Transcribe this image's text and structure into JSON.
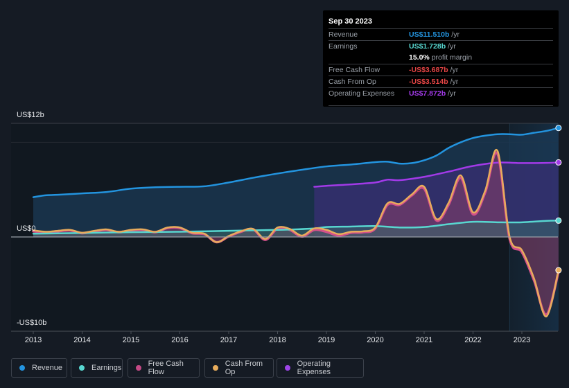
{
  "chart_data": {
    "type": "line",
    "title": "",
    "xlabel": "",
    "ylabel": "",
    "ylim": [
      -10,
      12
    ],
    "xlim": [
      2013,
      2023.75
    ],
    "y_ticks": [
      {
        "value": 12,
        "label": "US$12b"
      },
      {
        "value": 0,
        "label": "US$0"
      },
      {
        "value": -10,
        "label": "-US$10b"
      }
    ],
    "x_ticks": [
      "2013",
      "2014",
      "2015",
      "2016",
      "2017",
      "2018",
      "2019",
      "2020",
      "2021",
      "2022",
      "2023"
    ],
    "highlight_range": [
      2022.75,
      2023.75
    ],
    "legend_position": "bottom-left",
    "series": [
      {
        "name": "Revenue",
        "color": "#2394df",
        "fill": true,
        "x": [
          2013.0,
          2013.25,
          2013.5,
          2014.0,
          2014.5,
          2015.0,
          2015.5,
          2016.0,
          2016.5,
          2017.0,
          2017.5,
          2018.0,
          2018.5,
          2019.0,
          2019.5,
          2020.0,
          2020.25,
          2020.5,
          2020.75,
          2021.0,
          2021.25,
          2021.5,
          2021.75,
          2022.0,
          2022.25,
          2022.5,
          2022.75,
          2023.0,
          2023.25,
          2023.5,
          2023.75
        ],
        "values": [
          4.2,
          4.4,
          4.45,
          4.6,
          4.75,
          5.1,
          5.25,
          5.3,
          5.35,
          5.75,
          6.25,
          6.7,
          7.1,
          7.45,
          7.65,
          7.9,
          7.95,
          7.75,
          7.8,
          8.1,
          8.6,
          9.4,
          10.0,
          10.45,
          10.7,
          10.85,
          10.85,
          10.8,
          11.0,
          11.2,
          11.51
        ]
      },
      {
        "name": "Earnings",
        "color": "#58d7d0",
        "fill": true,
        "x": [
          2013.0,
          2014.0,
          2015.0,
          2016.0,
          2017.0,
          2018.0,
          2018.75,
          2019.0,
          2019.5,
          2020.0,
          2020.5,
          2021.0,
          2021.5,
          2022.0,
          2022.5,
          2023.0,
          2023.5,
          2023.75
        ],
        "values": [
          0.35,
          0.42,
          0.5,
          0.55,
          0.65,
          0.75,
          0.9,
          1.05,
          1.1,
          1.15,
          1.0,
          1.05,
          1.35,
          1.6,
          1.55,
          1.55,
          1.7,
          1.728
        ]
      },
      {
        "name": "Operating Expenses",
        "color": "#a23ae8",
        "fill": true,
        "x": [
          2018.75,
          2019.0,
          2019.5,
          2020.0,
          2020.25,
          2020.5,
          2021.0,
          2021.5,
          2022.0,
          2022.5,
          2023.0,
          2023.5,
          2023.75
        ],
        "values": [
          5.3,
          5.4,
          5.55,
          5.75,
          6.05,
          6.0,
          6.35,
          6.9,
          7.5,
          7.85,
          7.8,
          7.82,
          7.872
        ]
      },
      {
        "name": "Free Cash Flow",
        "color": "#d3518a",
        "fill": true,
        "x": [
          2013.0,
          2013.25,
          2013.5,
          2013.75,
          2014.0,
          2014.25,
          2014.5,
          2014.75,
          2015.0,
          2015.25,
          2015.5,
          2015.75,
          2016.0,
          2016.25,
          2016.5,
          2016.75,
          2017.0,
          2017.25,
          2017.5,
          2017.75,
          2018.0,
          2018.25,
          2018.5,
          2018.75,
          2019.0,
          2019.25,
          2019.5,
          2019.75,
          2020.0,
          2020.25,
          2020.5,
          2020.75,
          2021.0,
          2021.25,
          2021.5,
          2021.75,
          2022.0,
          2022.25,
          2022.5,
          2022.75,
          2023.0,
          2023.25,
          2023.5,
          2023.75
        ],
        "values": [
          0.6,
          0.5,
          0.6,
          0.7,
          0.4,
          0.6,
          0.75,
          0.5,
          0.7,
          0.75,
          0.5,
          0.95,
          0.95,
          0.4,
          0.3,
          -0.55,
          0.05,
          0.55,
          0.8,
          -0.3,
          0.9,
          0.75,
          0.05,
          0.75,
          0.55,
          0.15,
          0.45,
          0.5,
          0.9,
          3.4,
          3.4,
          4.4,
          5.1,
          1.75,
          3.4,
          6.25,
          2.4,
          4.7,
          8.8,
          -0.2,
          -1.6,
          -4.6,
          -8.2,
          -3.687
        ]
      },
      {
        "name": "Cash From Op",
        "color": "#e8ac5c",
        "fill": false,
        "x": [
          2013.0,
          2013.25,
          2013.5,
          2013.75,
          2014.0,
          2014.25,
          2014.5,
          2014.75,
          2015.0,
          2015.25,
          2015.5,
          2015.75,
          2016.0,
          2016.25,
          2016.5,
          2016.75,
          2017.0,
          2017.25,
          2017.5,
          2017.75,
          2018.0,
          2018.25,
          2018.5,
          2018.75,
          2019.0,
          2019.25,
          2019.5,
          2019.75,
          2020.0,
          2020.25,
          2020.5,
          2020.75,
          2021.0,
          2021.25,
          2021.5,
          2021.75,
          2022.0,
          2022.25,
          2022.5,
          2022.75,
          2023.0,
          2023.25,
          2023.5,
          2023.75
        ],
        "values": [
          0.7,
          0.55,
          0.65,
          0.75,
          0.45,
          0.65,
          0.8,
          0.55,
          0.75,
          0.8,
          0.55,
          1.0,
          1.0,
          0.45,
          0.35,
          -0.55,
          0.1,
          0.6,
          0.85,
          -0.2,
          1.0,
          0.85,
          0.15,
          0.9,
          0.75,
          0.3,
          0.55,
          0.6,
          1.0,
          3.55,
          3.5,
          4.5,
          5.3,
          1.9,
          3.6,
          6.5,
          2.6,
          4.9,
          9.1,
          0.0,
          -1.4,
          -4.4,
          -8.4,
          -3.514
        ]
      }
    ]
  },
  "tooltip": {
    "date": "Sep 30 2023",
    "rows": [
      {
        "label": "Revenue",
        "value": "US$11.510b",
        "unit": " /yr",
        "color": "#2394df"
      },
      {
        "label": "Earnings",
        "value": "US$1.728b",
        "unit": " /yr",
        "color": "#58d7d0"
      },
      {
        "label": "",
        "value": "15.0%",
        "unit": " profit margin",
        "color": "#ffffff"
      },
      {
        "label": "Free Cash Flow",
        "value": "-US$3.687b",
        "unit": " /yr",
        "color": "#e64545"
      },
      {
        "label": "Cash From Op",
        "value": "-US$3.514b",
        "unit": " /yr",
        "color": "#e64545"
      },
      {
        "label": "Operating Expenses",
        "value": "US$7.872b",
        "unit": " /yr",
        "color": "#a23ae8"
      }
    ]
  },
  "legend": [
    {
      "label": "Revenue",
      "color": "#2394df"
    },
    {
      "label": "Earnings",
      "color": "#58d7d0"
    },
    {
      "label": "Free Cash Flow",
      "color": "#c44a86"
    },
    {
      "label": "Cash From Op",
      "color": "#e8ac5c"
    },
    {
      "label": "Operating Expenses",
      "color": "#9d45e8"
    }
  ]
}
